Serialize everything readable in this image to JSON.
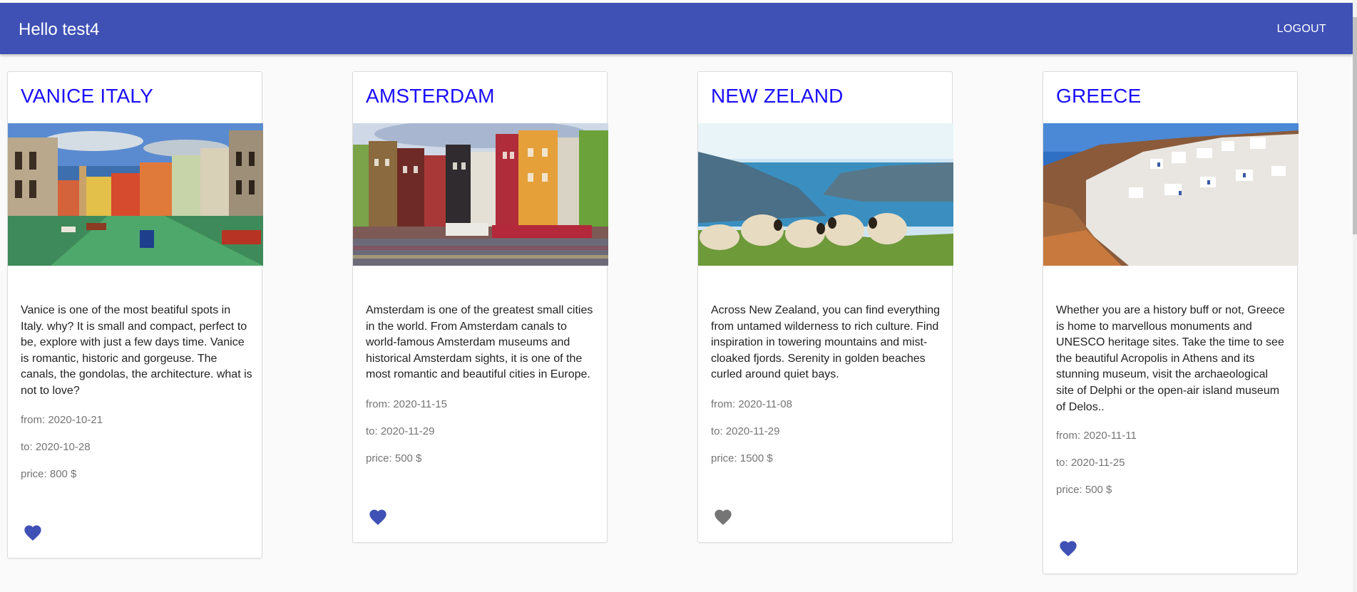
{
  "header": {
    "title": "Hello test4",
    "logout_label": "LOGOUT"
  },
  "trips": [
    {
      "title": "VANICE ITALY",
      "description": "Vanice is one of the most beatiful spots in Italy. why? It is small and compact, perfect to be, explore with just a few days time. Vanice is romantic, historic and gorgeuse. The canals, the gondolas, the architecture. what is not to love?",
      "from": "from: 2020-10-21",
      "to": "to: 2020-10-28",
      "price": "price: 800 $",
      "favorite": true
    },
    {
      "title": "AMSTERDAM",
      "description": "Amsterdam is one of the greatest small cities in the world. From Amsterdam canals to world-famous Amsterdam museums and historical Amsterdam sights, it is one of the most romantic and beautiful cities in Europe.",
      "from": "from: 2020-11-15",
      "to": "to: 2020-11-29",
      "price": "price: 500 $",
      "favorite": true
    },
    {
      "title": "NEW ZELAND",
      "description": "Across New Zealand, you can find everything from untamed wilderness to rich culture. Find inspiration in towering mountains and mist-cloaked fjords. Serenity in golden beaches curled around quiet bays.",
      "from": "from: 2020-11-08",
      "to": "to: 2020-11-29",
      "price": "price: 1500 $",
      "favorite": false
    },
    {
      "title": "GREECE",
      "description": "Whether you are a history buff or not, Greece is home to marvellous monuments and UNESCO heritage sites. Take the time to see the beautiful Acropolis in Athens and its stunning museum, visit the archaeological site of Delphi or the open-air island museum of Delos..",
      "from": "from: 2020-11-11",
      "to": "to: 2020-11-25",
      "price": "price: 500 $",
      "favorite": true
    }
  ],
  "colors": {
    "primary": "#3f51b5",
    "title_link": "#1a0dff",
    "favorite_active": "#3f51b5",
    "favorite_inactive": "#757575"
  },
  "icons": {
    "favorite": "heart-icon"
  }
}
